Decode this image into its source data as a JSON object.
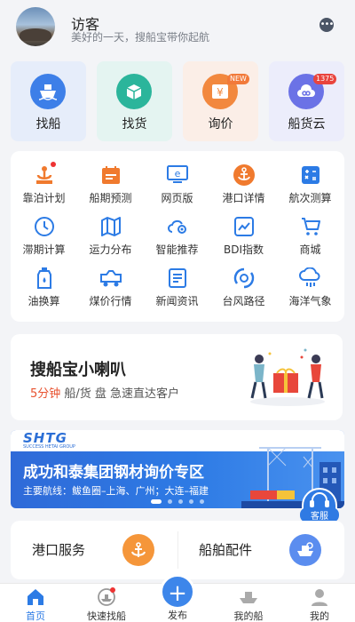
{
  "header": {
    "user_name": "访客",
    "user_subtitle": "美好的一天，搜船宝带你起航"
  },
  "top_cards": [
    {
      "label": "找船",
      "icon": "ship-icon",
      "bg": "#e6edfa",
      "icon_color": "#3d7fe8"
    },
    {
      "label": "找货",
      "icon": "cargo-box-icon",
      "bg": "#e4f4f1",
      "icon_color": "#2bb59b"
    },
    {
      "label": "询价",
      "icon": "yen-price-icon",
      "bg": "#fbeee7",
      "icon_color": "#f2883e",
      "badge": "NEW"
    },
    {
      "label": "船货云",
      "icon": "cloud-link-icon",
      "bg": "#ecedfb",
      "icon_color": "#6b72e6",
      "badge": "1375"
    }
  ],
  "grid": [
    {
      "label": "靠泊计划",
      "icon": "berth-plan-icon",
      "color": "#f07a2e",
      "dot": true
    },
    {
      "label": "船期预测",
      "icon": "calendar-icon",
      "color": "#f07a2e"
    },
    {
      "label": "网页版",
      "icon": "desktop-web-icon",
      "color": "#2c7be5"
    },
    {
      "label": "港口详情",
      "icon": "anchor-icon",
      "color": "#f07a2e"
    },
    {
      "label": "航次测算",
      "icon": "calculator-icon",
      "color": "#2c7be5"
    },
    {
      "label": "滞期计算",
      "icon": "clock-icon",
      "color": "#2c7be5"
    },
    {
      "label": "运力分布",
      "icon": "map-icon",
      "color": "#2c7be5"
    },
    {
      "label": "智能推荐",
      "icon": "smart-recommend-icon",
      "color": "#2c7be5"
    },
    {
      "label": "BDI指数",
      "icon": "bdi-index-icon",
      "color": "#2c7be5"
    },
    {
      "label": "商城",
      "icon": "cart-icon",
      "color": "#2c7be5"
    },
    {
      "label": "油换算",
      "icon": "oil-bottle-icon",
      "color": "#2c7be5"
    },
    {
      "label": "煤价行情",
      "icon": "coal-truck-icon",
      "color": "#2c7be5"
    },
    {
      "label": "新闻资讯",
      "icon": "news-icon",
      "color": "#2c7be5"
    },
    {
      "label": "台风路径",
      "icon": "typhoon-icon",
      "color": "#2c7be5"
    },
    {
      "label": "海洋气象",
      "icon": "weather-icon",
      "color": "#2c7be5"
    }
  ],
  "promo": {
    "title": "搜船宝小喇叭",
    "sub_highlight": "5分钟",
    "sub_rest": " 船/货 盘 急速直达客户"
  },
  "banner": {
    "logo": "SHTG",
    "logo_sub": "SUCCESS HETAI GROUP",
    "title": "成功和泰集团钢材询价专区",
    "subtitle": "主要航线：鲅鱼圈–上海、广州；大连–福建"
  },
  "customer_service": "客服",
  "services": [
    {
      "label": "港口服务",
      "icon": "anchor-icon",
      "color": "#f5963a"
    },
    {
      "label": "船舶配件",
      "icon": "ship-parts-icon",
      "color": "#5b8def"
    }
  ],
  "nav": [
    {
      "label": "首页",
      "icon": "home-icon",
      "active": true
    },
    {
      "label": "快速找船",
      "icon": "fast-ship-icon"
    },
    {
      "label": "发布",
      "icon": "plus-icon"
    },
    {
      "label": "我的船",
      "icon": "my-ship-icon"
    },
    {
      "label": "我的",
      "icon": "user-icon"
    }
  ]
}
